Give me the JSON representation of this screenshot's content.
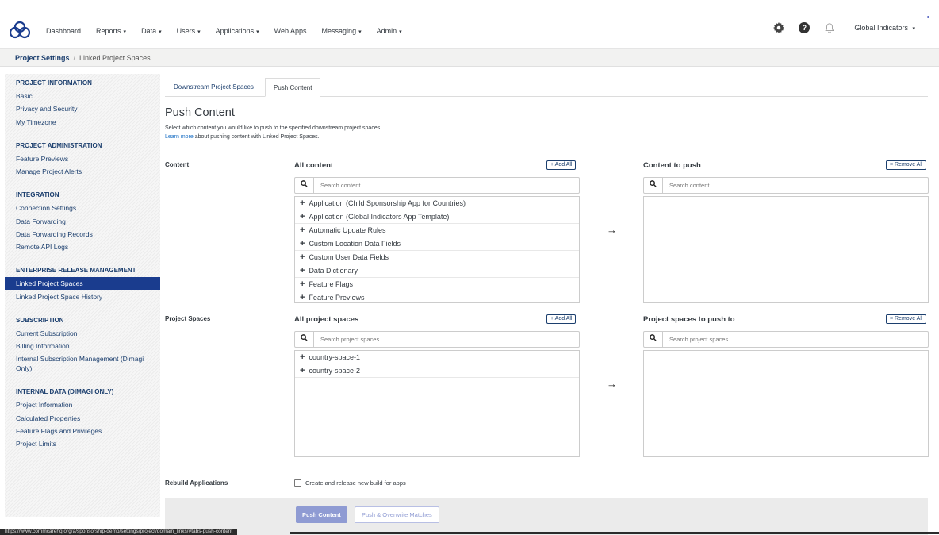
{
  "nav": {
    "logo_icon": "commcare-logo-icon",
    "items": [
      {
        "label": "Dashboard",
        "caret": false
      },
      {
        "label": "Reports",
        "caret": true
      },
      {
        "label": "Data",
        "caret": true
      },
      {
        "label": "Users",
        "caret": true
      },
      {
        "label": "Applications",
        "caret": true
      },
      {
        "label": "Web Apps",
        "caret": false
      },
      {
        "label": "Messaging",
        "caret": true
      },
      {
        "label": "Admin",
        "caret": true
      }
    ],
    "help_glyph": "?",
    "domain": "Global Indicators",
    "caret_glyph": "▾"
  },
  "breadcrumb": {
    "root": "Project Settings",
    "separator": "/",
    "current": "Linked Project Spaces"
  },
  "sidebar": {
    "sections": [
      {
        "heading": "PROJECT INFORMATION",
        "items": [
          "Basic",
          "Privacy and Security",
          "My Timezone"
        ]
      },
      {
        "heading": "PROJECT ADMINISTRATION",
        "items": [
          "Feature Previews",
          "Manage Project Alerts"
        ]
      },
      {
        "heading": "INTEGRATION",
        "items": [
          "Connection Settings",
          "Data Forwarding",
          "Data Forwarding Records",
          "Remote API Logs"
        ]
      },
      {
        "heading": "ENTERPRISE RELEASE MANAGEMENT",
        "items": [
          "Linked Project Spaces",
          "Linked Project Space History"
        ]
      },
      {
        "heading": "SUBSCRIPTION",
        "items": [
          "Current Subscription",
          "Billing Information",
          "Internal Subscription Management (Dimagi Only)"
        ]
      },
      {
        "heading": "INTERNAL DATA (DIMAGI ONLY)",
        "items": [
          "Project Information",
          "Calculated Properties",
          "Feature Flags and Privileges",
          "Project Limits"
        ]
      }
    ],
    "active_item": "Linked Project Spaces"
  },
  "tabs": [
    {
      "label": "Downstream Project Spaces",
      "active": false
    },
    {
      "label": "Push Content",
      "active": true
    }
  ],
  "main": {
    "title": "Push Content",
    "description": "Select which content you would like to push to the specified downstream project spaces.",
    "learn_more_link": "Learn more",
    "learn_more_rest": " about pushing content with Linked Project Spaces.",
    "content_label": "Content",
    "all_content_title": "All content",
    "add_all": "+ Add All",
    "remove_all": "× Remove All",
    "content_to_push_title": "Content to push",
    "search_content_placeholder": "Search content",
    "content_items": [
      "Application (Child Sponsorship App for Countries)",
      "Application (Global Indicators App Template)",
      "Automatic Update Rules",
      "Custom Location Data Fields",
      "Custom User Data Fields",
      "Data Dictionary",
      "Feature Flags",
      "Feature Previews"
    ],
    "project_spaces_label": "Project Spaces",
    "all_project_spaces_title": "All project spaces",
    "project_spaces_to_push_title": "Project spaces to push to",
    "search_project_spaces_placeholder": "Search project spaces",
    "project_space_items": [
      "country-space-1",
      "country-space-2"
    ],
    "arrow_glyph": "→",
    "plus_glyph": "+",
    "rebuild_label": "Rebuild Applications",
    "rebuild_checkbox_label": "Create and release new build for apps",
    "rebuild_checked": false,
    "push_button": "Push Content",
    "push_overwrite_button": "Push & Overwrite Matches"
  },
  "status_url": "https://www.commcarehq.org/a/sponsorship-demo/settings/project/domain_links/#tabs-push-content",
  "colors": {
    "primary": "#1c3f6e",
    "active_nav": "#1a3c8e",
    "link": "#1a6fc4",
    "button_disabled": "#8f9bd3"
  }
}
